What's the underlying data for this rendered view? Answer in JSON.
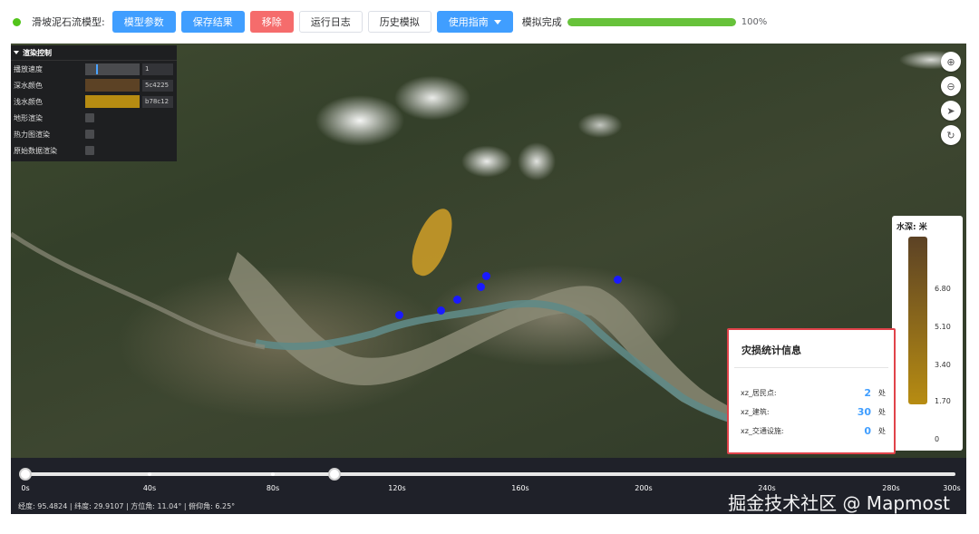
{
  "toolbar": {
    "model_label": "滑坡泥石流模型:",
    "buttons": {
      "model_params": "模型参数",
      "save_result": "保存结果",
      "remove": "移除",
      "run_log": "运行日志",
      "history": "历史模拟",
      "guide": "使用指南"
    },
    "sim_status": "模拟完成",
    "progress_fraction": 1.0,
    "progress_text": "100%",
    "colors": {
      "primary": "#409eff",
      "danger": "#f56c6c",
      "success": "#67c23a"
    }
  },
  "render_panel": {
    "title": "渲染控制",
    "rows": {
      "speed": {
        "label": "播放速度",
        "value": "1"
      },
      "deep": {
        "label": "深水颜色",
        "value": "5c4225",
        "color": "#5c4225"
      },
      "shallow": {
        "label": "浅水颜色",
        "value": "b78c12",
        "color": "#b78c12"
      },
      "terrain": {
        "label": "地形渲染"
      },
      "heatmap": {
        "label": "热力图渲染"
      },
      "raw": {
        "label": "原始数据渲染"
      }
    }
  },
  "map_controls": {
    "zoom_in": "⊕",
    "zoom_out": "⊖",
    "locate": "➤",
    "reset": "↻"
  },
  "legend": {
    "title": "水深: 米",
    "ticks": [
      "6.80",
      "5.10",
      "3.40",
      "1.70",
      "0"
    ]
  },
  "damage": {
    "title": "灾损统计信息",
    "rows": [
      {
        "name": "xz_居民点:",
        "count": "2",
        "unit": "处"
      },
      {
        "name": "xz_建筑:",
        "count": "30",
        "unit": "处"
      },
      {
        "name": "xz_交通设施:",
        "count": "0",
        "unit": "处"
      }
    ]
  },
  "timeline": {
    "labels": [
      "0s",
      "40s",
      "80s",
      "120s",
      "160s",
      "200s",
      "240s",
      "280s",
      "300s"
    ],
    "coords": "经度: 95.4824  |  纬度: 29.9107  |  方位角: 11.04°  |  俯仰角: 6.25°"
  },
  "watermark": "掘金技术社区 @ Mapmost"
}
